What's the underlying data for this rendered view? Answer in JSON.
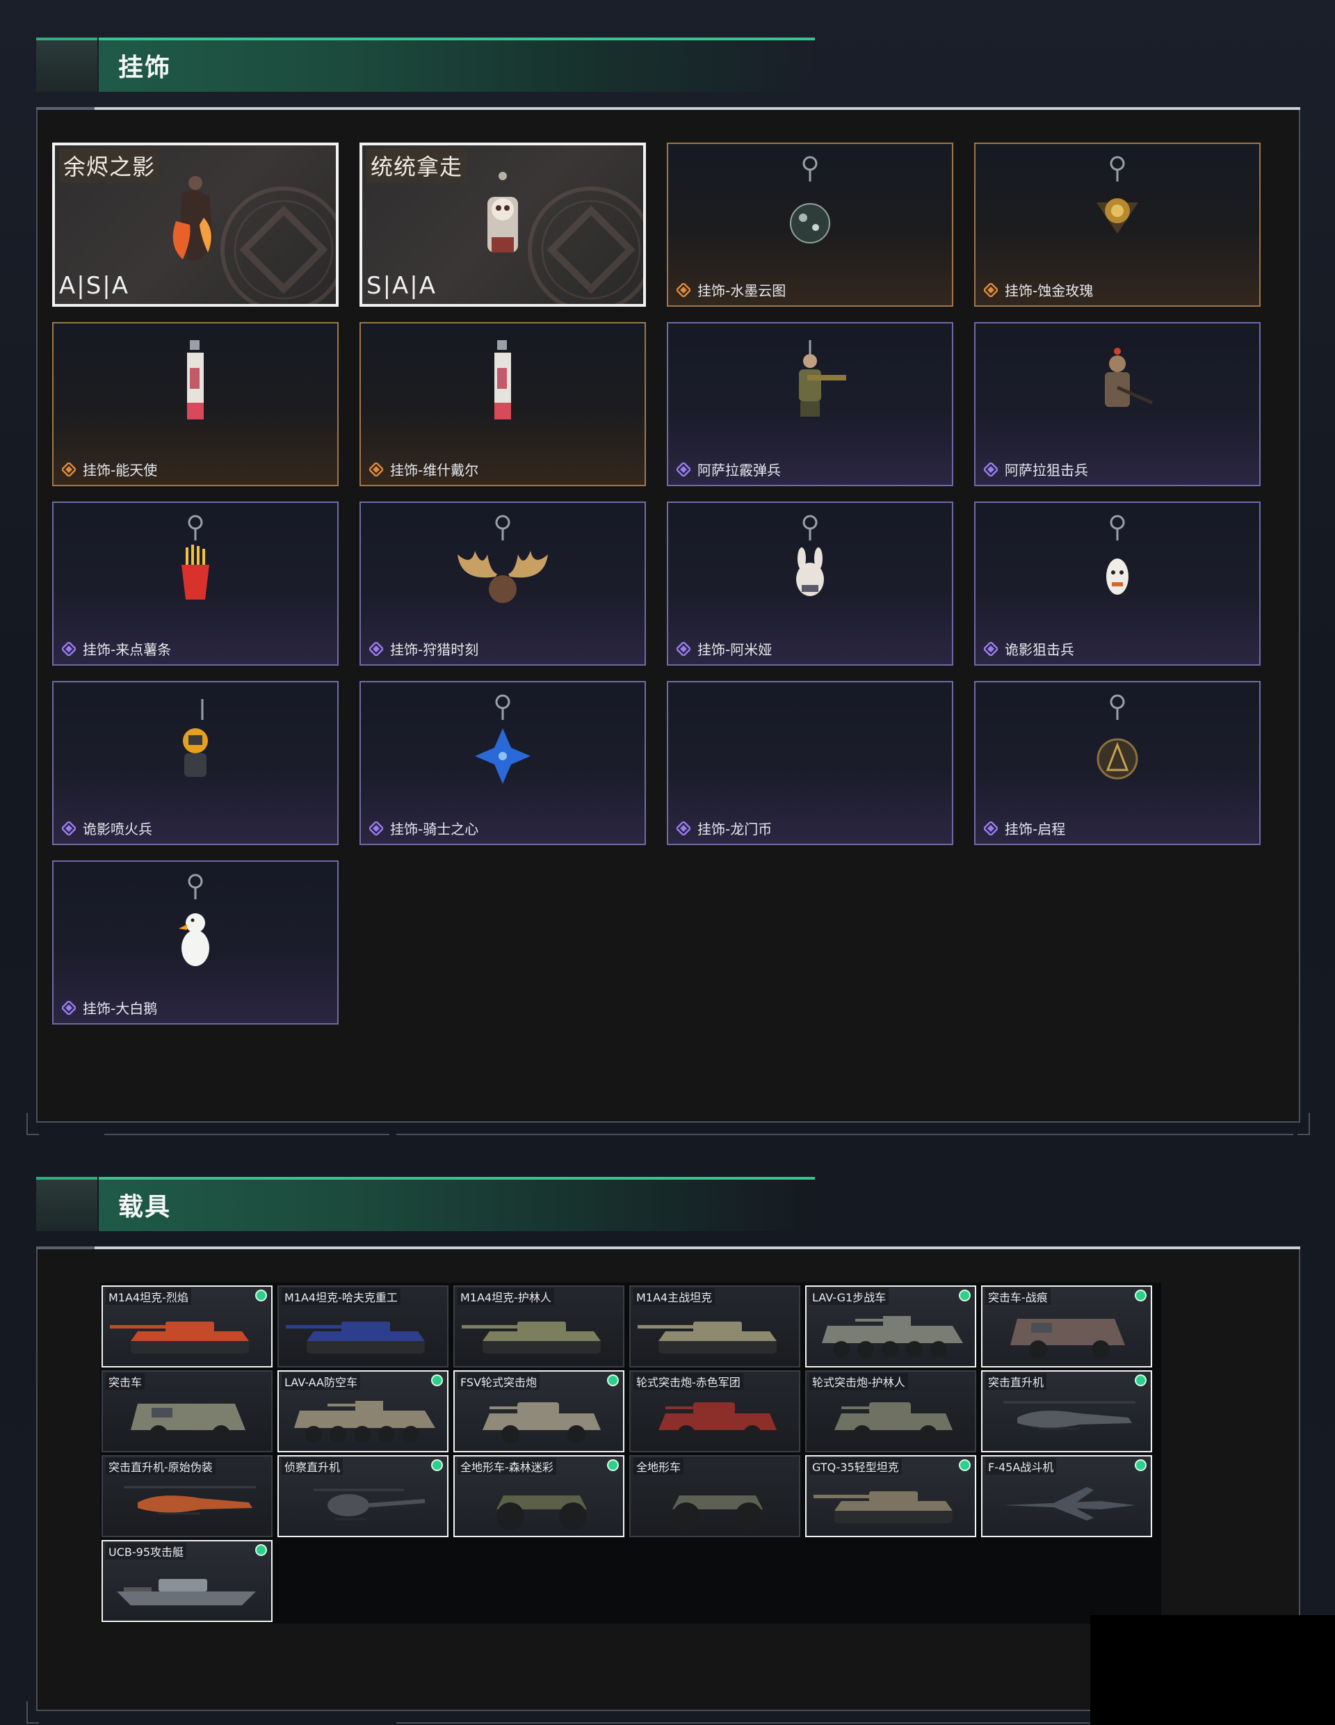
{
  "charms_section": {
    "title": "挂饰",
    "items": [
      {
        "name": "余烬之影",
        "brand": "A|S|A",
        "style": "special",
        "icon": "flame-knight-charm"
      },
      {
        "name": "统统拿走",
        "brand": "S|A|A",
        "style": "special",
        "icon": "skull-throne-charm"
      },
      {
        "name": "挂饰-水墨云图",
        "style": "gold",
        "icon": "ink-orb-charm"
      },
      {
        "name": "挂饰-蚀金玫瑰",
        "style": "gold",
        "icon": "gold-rose-charm"
      },
      {
        "name": "挂饰-能天使",
        "style": "gold",
        "icon": "tag-charm"
      },
      {
        "name": "挂饰-维什戴尔",
        "style": "gold",
        "icon": "tag-charm"
      },
      {
        "name": "阿萨拉霰弹兵",
        "style": "purple",
        "icon": "soldier-figure-charm"
      },
      {
        "name": "阿萨拉狙击兵",
        "style": "purple",
        "icon": "sniper-figure-charm"
      },
      {
        "name": "挂饰-来点薯条",
        "style": "purple",
        "icon": "fries-charm"
      },
      {
        "name": "挂饰-狩猎时刻",
        "style": "purple",
        "icon": "moose-antler-charm"
      },
      {
        "name": "挂饰-阿米娅",
        "style": "purple",
        "icon": "bunny-charm"
      },
      {
        "name": "诡影狙击兵",
        "style": "purple",
        "icon": "ghost-sniper-charm"
      },
      {
        "name": "诡影喷火兵",
        "style": "purple",
        "icon": "flamethrower-charm"
      },
      {
        "name": "挂饰-骑士之心",
        "style": "purple",
        "icon": "blue-cross-charm"
      },
      {
        "name": "挂饰-龙门币",
        "style": "purple",
        "icon": "empty"
      },
      {
        "name": "挂饰-启程",
        "style": "purple",
        "icon": "coin-charm"
      },
      {
        "name": "挂饰-大白鹅",
        "style": "purple",
        "icon": "goose-charm"
      }
    ]
  },
  "vehicles_section": {
    "title": "载具",
    "items": [
      {
        "name": "M1A4坦克-烈焰",
        "owned": true,
        "kind": "tank",
        "color": "#c44a2a"
      },
      {
        "name": "M1A4坦克-哈夫克重工",
        "owned": false,
        "kind": "tank",
        "color": "#2d3f8c"
      },
      {
        "name": "M1A4坦克-护林人",
        "owned": false,
        "kind": "tank",
        "color": "#7c7f5e"
      },
      {
        "name": "M1A4主战坦克",
        "owned": false,
        "kind": "tank",
        "color": "#8d8a70"
      },
      {
        "name": "LAV-G1步战车",
        "owned": true,
        "kind": "apc",
        "color": "#7a7d74"
      },
      {
        "name": "突击车-战痕",
        "owned": true,
        "kind": "truck",
        "color": "#6b5a55"
      },
      {
        "name": "突击车",
        "owned": false,
        "kind": "truck",
        "color": "#7d7f6e"
      },
      {
        "name": "LAV-AA防空车",
        "owned": true,
        "kind": "apc",
        "color": "#8a8470"
      },
      {
        "name": "FSV轮式突击炮",
        "owned": true,
        "kind": "armored-car",
        "color": "#8f8a7a"
      },
      {
        "name": "轮式突击炮-赤色军团",
        "owned": false,
        "kind": "armored-car",
        "color": "#8c2e2a"
      },
      {
        "name": "轮式突击炮-护林人",
        "owned": false,
        "kind": "armored-car",
        "color": "#6f7262"
      },
      {
        "name": "突击直升机",
        "owned": true,
        "kind": "helicopter",
        "color": "#555a60"
      },
      {
        "name": "突击直升机-原始伪装",
        "owned": false,
        "kind": "helicopter",
        "color": "#b5562c"
      },
      {
        "name": "侦察直升机",
        "owned": true,
        "kind": "scout-heli",
        "color": "#4d5157"
      },
      {
        "name": "全地形车-森林迷彩",
        "owned": true,
        "kind": "atv",
        "color": "#5c6048"
      },
      {
        "name": "全地形车",
        "owned": false,
        "kind": "atv",
        "color": "#5e6054"
      },
      {
        "name": "GTQ-35轻型坦克",
        "owned": true,
        "kind": "tank",
        "color": "#7c7460"
      },
      {
        "name": "F-45A战斗机",
        "owned": true,
        "kind": "jet",
        "color": "#4c535c"
      },
      {
        "name": "UCB-95攻击艇",
        "owned": true,
        "kind": "boat",
        "color": "#6b7078"
      }
    ]
  },
  "colors": {
    "accent_green": "#36c58e",
    "rarity_purple": "#9a7cf0",
    "rarity_gold": "#e08a3a",
    "owned_dot": "#2bd18b"
  }
}
